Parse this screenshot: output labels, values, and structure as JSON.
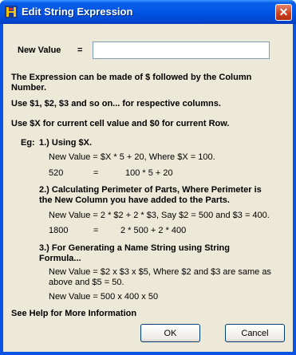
{
  "window": {
    "title": "Edit String Expression",
    "close_glyph": "✕",
    "app_icon": "app-icon"
  },
  "form": {
    "new_value_label": "New Value",
    "equals": "=",
    "new_value_input": ""
  },
  "info": {
    "line1": "The Expression can be made of $ followed by the Column",
    "line2": "Number.",
    "line3": "Use $1, $2, $3 and so on... for respective columns.",
    "line4": "Use $X for current cell value and $0 for current Row."
  },
  "examples": {
    "eg_label": "Eg:",
    "ex1": {
      "heading": "1.) Using $X.",
      "line1": "New Value =  $X * 5 + 20,    Where $X = 100.",
      "result_left": "520",
      "result_eq": "=",
      "result_right": "100 * 5 + 20"
    },
    "ex2": {
      "heading1": "2.) Calculating Perimeter of Parts, Where Perimeter is",
      "heading2": "the New Column you have added to the Parts.",
      "line1": "New Value =  2 * $2 + 2 * $3,  Say $2 = 500 and $3 =  400.",
      "result_left": "1800",
      "result_eq": "=",
      "result_right": "2 * 500 + 2 * 400"
    },
    "ex3": {
      "heading1": "3.) For Generating a Name String using String",
      "heading2": "Formula...",
      "line1": "New Value =  $2 x $3 x $5, Where $2 and $3 are same as",
      "line2": "above and $5 = 50.",
      "line3": "New Value  =  500 x 400 x 50"
    }
  },
  "help": "See Help for More Information",
  "buttons": {
    "ok": "OK",
    "cancel": "Cancel"
  },
  "colors": {
    "titlebar": "#0055e5",
    "client": "#ece9d8",
    "close": "#c83f1c"
  }
}
